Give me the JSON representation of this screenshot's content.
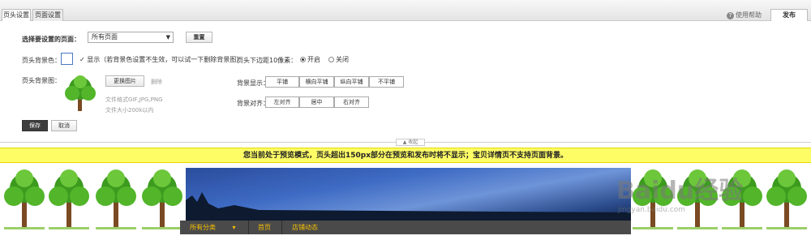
{
  "tabs": [
    "页头设置",
    "页面设置"
  ],
  "help": "使用帮助",
  "publish": "发布",
  "page_select": {
    "label": "选择要设置的页面：",
    "value": "所有页面",
    "reset": "重置"
  },
  "bg_color": {
    "label": "页头背景色：",
    "checkbox_text": "显示（若背景色设置不生效，可以试一下删除背景图）"
  },
  "margin": {
    "label": "页头下边距10像素：",
    "on": "开启",
    "off": "关闭"
  },
  "bg_image": {
    "label": "页头背景图：",
    "change": "更换图片",
    "delete": "删除",
    "format": "文件格式GIF,JPG,PNG",
    "size": "文件大小200k以内"
  },
  "display": {
    "label": "背景显示：",
    "options": [
      "平铺",
      "横向平铺",
      "纵向平铺",
      "不平铺"
    ]
  },
  "align": {
    "label": "背景对齐：",
    "options": [
      "左对齐",
      "居中",
      "右对齐"
    ]
  },
  "actions": {
    "save": "保存",
    "cancel": "取消"
  },
  "collapse": "收起",
  "notice": "您当前处于预览模式，页头超出150px部分在预览和发布时将不显示；宝贝详情页不支持页面背景。",
  "nav": [
    "所有分类",
    "首页",
    "店铺动态"
  ],
  "watermark": "Baidu经验",
  "watermark_sub": "jingyan.baidu.com",
  "colors": {
    "notice_bg": "#fffd66",
    "nav_bg": "#4a4a4a",
    "nav_text": "#f5c000"
  }
}
